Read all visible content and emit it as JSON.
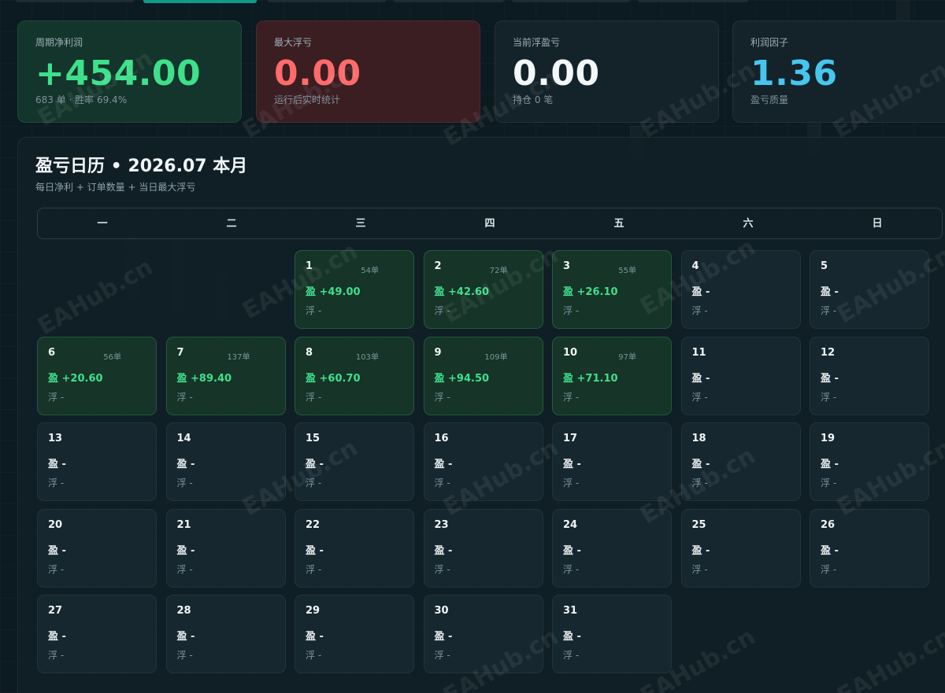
{
  "stats": [
    {
      "label": "周期净利润",
      "value": "+454.00",
      "sub": "683 单 · 胜率 69.4%"
    },
    {
      "label": "最大浮亏",
      "value": "0.00",
      "sub": "运行后实时统计"
    },
    {
      "label": "当前浮盈亏",
      "value": "0.00",
      "sub": "持仓 0 笔"
    },
    {
      "label": "利润因子",
      "value": "1.36",
      "sub": "盈亏质量"
    }
  ],
  "calendar": {
    "title": "盈亏日历 • 2026.07 本月",
    "subtitle": "每日净利 + 订单数量 + 当日最大浮亏",
    "weekdays": [
      "一",
      "二",
      "三",
      "四",
      "五",
      "六",
      "日"
    ],
    "days": [
      {
        "day": "1",
        "orders": "54单",
        "pnl": "盈 +49.00",
        "float": "浮 -",
        "profit": true
      },
      {
        "day": "2",
        "orders": "72单",
        "pnl": "盈 +42.60",
        "float": "浮 -",
        "profit": true
      },
      {
        "day": "3",
        "orders": "55单",
        "pnl": "盈 +26.10",
        "float": "浮 -",
        "profit": true
      },
      {
        "day": "4",
        "orders": "",
        "pnl": "盈 -",
        "float": "浮 -",
        "profit": false
      },
      {
        "day": "5",
        "orders": "",
        "pnl": "盈 -",
        "float": "浮 -",
        "profit": false
      },
      {
        "day": "6",
        "orders": "56单",
        "pnl": "盈 +20.60",
        "float": "浮 -",
        "profit": true
      },
      {
        "day": "7",
        "orders": "137单",
        "pnl": "盈 +89.40",
        "float": "浮 -",
        "profit": true
      },
      {
        "day": "8",
        "orders": "103单",
        "pnl": "盈 +60.70",
        "float": "浮 -",
        "profit": true
      },
      {
        "day": "9",
        "orders": "109单",
        "pnl": "盈 +94.50",
        "float": "浮 -",
        "profit": true
      },
      {
        "day": "10",
        "orders": "97单",
        "pnl": "盈 +71.10",
        "float": "浮 -",
        "profit": true
      },
      {
        "day": "11",
        "orders": "",
        "pnl": "盈 -",
        "float": "浮 -",
        "profit": false
      },
      {
        "day": "12",
        "orders": "",
        "pnl": "盈 -",
        "float": "浮 -",
        "profit": false
      },
      {
        "day": "13",
        "orders": "",
        "pnl": "盈 -",
        "float": "浮 -",
        "profit": false
      },
      {
        "day": "14",
        "orders": "",
        "pnl": "盈 -",
        "float": "浮 -",
        "profit": false
      },
      {
        "day": "15",
        "orders": "",
        "pnl": "盈 -",
        "float": "浮 -",
        "profit": false
      },
      {
        "day": "16",
        "orders": "",
        "pnl": "盈 -",
        "float": "浮 -",
        "profit": false
      },
      {
        "day": "17",
        "orders": "",
        "pnl": "盈 -",
        "float": "浮 -",
        "profit": false
      },
      {
        "day": "18",
        "orders": "",
        "pnl": "盈 -",
        "float": "浮 -",
        "profit": false
      },
      {
        "day": "19",
        "orders": "",
        "pnl": "盈 -",
        "float": "浮 -",
        "profit": false
      },
      {
        "day": "20",
        "orders": "",
        "pnl": "盈 -",
        "float": "浮 -",
        "profit": false
      },
      {
        "day": "21",
        "orders": "",
        "pnl": "盈 -",
        "float": "浮 -",
        "profit": false
      },
      {
        "day": "22",
        "orders": "",
        "pnl": "盈 -",
        "float": "浮 -",
        "profit": false
      },
      {
        "day": "23",
        "orders": "",
        "pnl": "盈 -",
        "float": "浮 -",
        "profit": false
      },
      {
        "day": "24",
        "orders": "",
        "pnl": "盈 -",
        "float": "浮 -",
        "profit": false
      },
      {
        "day": "25",
        "orders": "",
        "pnl": "盈 -",
        "float": "浮 -",
        "profit": false
      },
      {
        "day": "26",
        "orders": "",
        "pnl": "盈 -",
        "float": "浮 -",
        "profit": false
      },
      {
        "day": "27",
        "orders": "",
        "pnl": "盈 -",
        "float": "浮 -",
        "profit": false
      },
      {
        "day": "28",
        "orders": "",
        "pnl": "盈 -",
        "float": "浮 -",
        "profit": false
      },
      {
        "day": "29",
        "orders": "",
        "pnl": "盈 -",
        "float": "浮 -",
        "profit": false
      },
      {
        "day": "30",
        "orders": "",
        "pnl": "盈 -",
        "float": "浮 -",
        "profit": false
      },
      {
        "day": "31",
        "orders": "",
        "pnl": "盈 -",
        "float": "浮 -",
        "profit": false
      }
    ]
  },
  "watermark": "EAHub.cn",
  "colors": {
    "profit": "#3ee08c",
    "loss": "#ff6b6b",
    "factor": "#46c6ee",
    "accent": "#129a86"
  }
}
